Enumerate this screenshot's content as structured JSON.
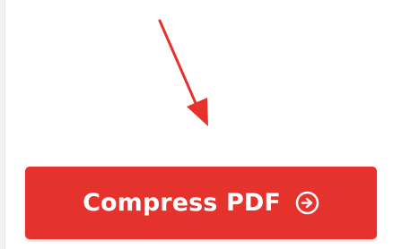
{
  "button": {
    "label": "Compress PDF",
    "icon": "arrow-right-circle-icon",
    "color": "#e5322d"
  },
  "annotation": {
    "arrow_icon": "arrow-pointer-icon",
    "color": "#e5322d"
  }
}
